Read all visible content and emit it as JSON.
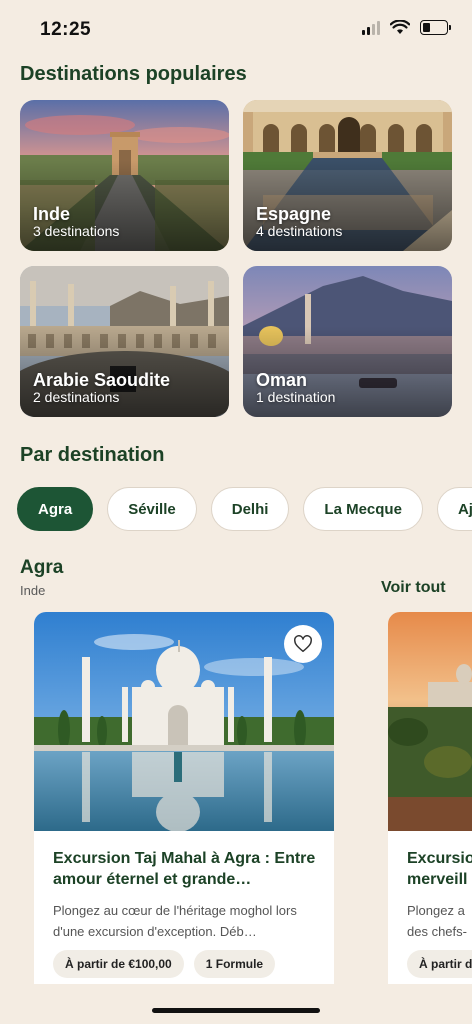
{
  "status_bar": {
    "time": "12:25",
    "battery_level": 0.3
  },
  "sections": {
    "popular_title": "Destinations populaires",
    "by_destination_title": "Par destination"
  },
  "popular_destinations": [
    {
      "name": "Inde",
      "count": "3 destinations"
    },
    {
      "name": "Espagne",
      "count": "4 destinations"
    },
    {
      "name": "Arabie Saoudite",
      "count": "2 destinations"
    },
    {
      "name": "Oman",
      "count": "1 destination"
    }
  ],
  "filter_chips": [
    {
      "label": "Agra",
      "active": true
    },
    {
      "label": "Séville",
      "active": false
    },
    {
      "label": "Delhi",
      "active": false
    },
    {
      "label": "La Mecque",
      "active": false
    },
    {
      "label": "Aj",
      "active": false
    }
  ],
  "group": {
    "title": "Agra",
    "subtitle": "Inde",
    "see_all": "Voir tout"
  },
  "tours": [
    {
      "title": "Excursion Taj Mahal à Agra : Entre amour éternel et grande…",
      "description": "Plongez au cœur de l'héritage moghol lors d'une excursion d'exception. Déb…",
      "price": "À partir de €100,00",
      "formula": "1 Formule"
    },
    {
      "title": "Excursio merveill",
      "description": "Plongez a des chefs-",
      "price": "À partir de"
    }
  ],
  "colors": {
    "background": "#f4ece2",
    "accent": "#1d5535",
    "heading": "#1c4226"
  },
  "icons": {
    "favorite": "heart-outline-icon",
    "wifi": "wifi-icon",
    "signal": "cellular-signal-icon",
    "battery": "battery-icon"
  }
}
